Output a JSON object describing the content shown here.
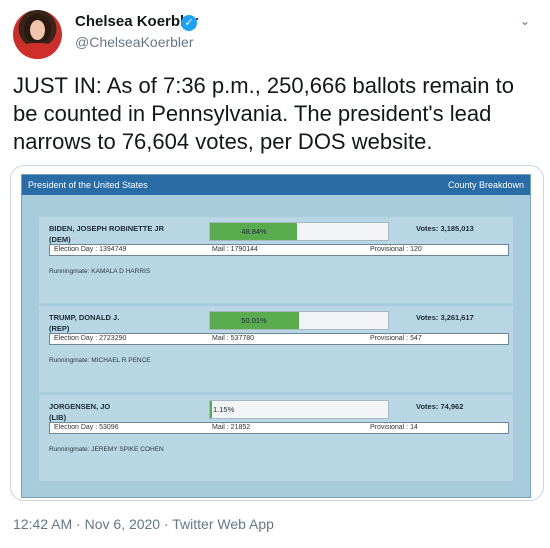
{
  "author": {
    "name": "Chelsea Koerbler",
    "handle": "@ChelseaKoerbler",
    "verified_glyph": "✓"
  },
  "menu_glyph": "⌄",
  "tweet": {
    "text": "JUST IN: As of 7:36 p.m., 250,666 ballots remain to be counted in Pennsylvania. The president's lead narrows to 76,604 votes, per DOS website."
  },
  "screenshot": {
    "header_title": "President of the United States",
    "header_link": "County Breakdown",
    "candidates": [
      {
        "name": "BIDEN, JOSEPH ROBINETTE JR",
        "party": "(DEM)",
        "percent_label": "48.84%",
        "percent": 48.84,
        "votes": "Votes: 3,185,013",
        "election_day": "Election Day : 1394749",
        "mail": "Mail : 1790144",
        "provisional": "Provisional : 120",
        "runningmate": "Runningmate: KAMALA D HARRIS"
      },
      {
        "name": "TRUMP, DONALD J.",
        "party": "(REP)",
        "percent_label": "50.01%",
        "percent": 50.01,
        "votes": "Votes: 3,261,617",
        "election_day": "Election Day : 2723290",
        "mail": "Mail : 537780",
        "provisional": "Provisional : 547",
        "runningmate": "Runningmate: MICHAEL R PENCE"
      },
      {
        "name": "JORGENSEN, JO",
        "party": "(LIB)",
        "percent_label": "1.15%",
        "percent": 1.15,
        "votes": "Votes: 74,962",
        "election_day": "Election Day : 53096",
        "mail": "Mail : 21852",
        "provisional": "Provisional : 14",
        "runningmate": "Runningmate: JEREMY SPIKE COHEN"
      }
    ]
  },
  "footer": {
    "timestamp": "12:42 AM · Nov 6, 2020 · Twitter Web App"
  },
  "colors": {
    "verified": "#1da1f2",
    "panel_header": "#2a6ca6",
    "bar_fill": "#5aab4e"
  }
}
